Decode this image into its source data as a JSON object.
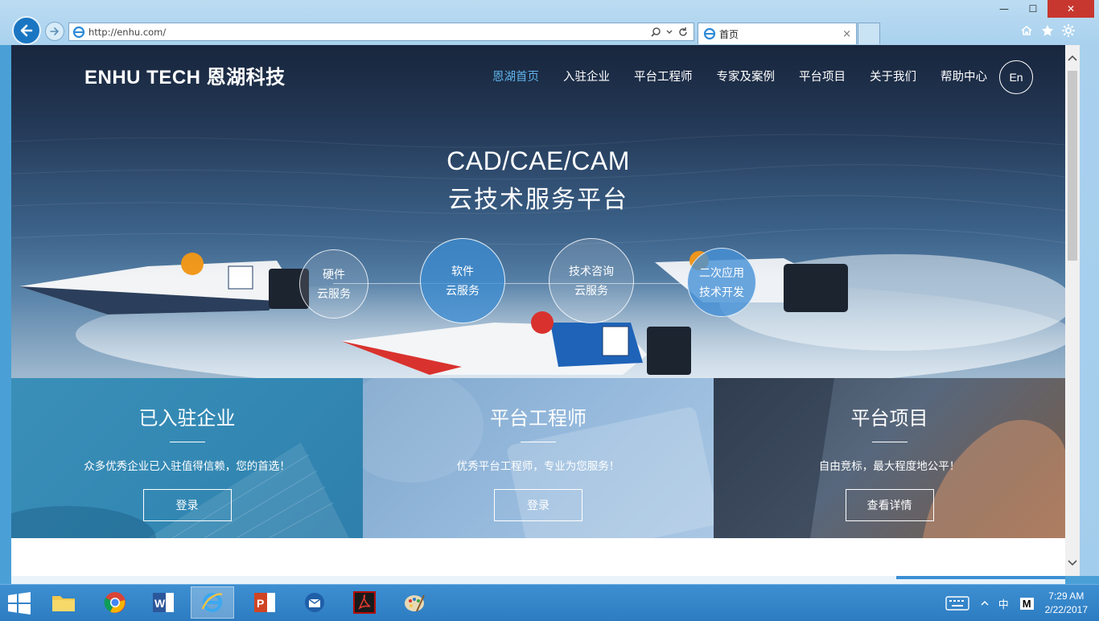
{
  "browser": {
    "url": "http://enhu.com/",
    "tab_title": "首页",
    "tab_close": "×",
    "window": {
      "minimize": "—",
      "maximize": "☐",
      "close": "✕"
    }
  },
  "site": {
    "brand": "ENHU TECH 恩湖科技",
    "nav": [
      {
        "label": "恩湖首页",
        "active": true
      },
      {
        "label": "入驻企业"
      },
      {
        "label": "平台工程师"
      },
      {
        "label": "专家及案例"
      },
      {
        "label": "平台项目"
      },
      {
        "label": "关于我们"
      },
      {
        "label": "帮助中心"
      }
    ],
    "lang_button": "En",
    "hero": {
      "title_line1": "CAD/CAE/CAM",
      "title_line2": "云技术服务平台",
      "services": [
        {
          "line1": "硬件",
          "line2": "云服务"
        },
        {
          "line1": "软件",
          "line2": "云服务"
        },
        {
          "line1": "技术咨询",
          "line2": "云服务"
        },
        {
          "line1": "二次应用",
          "line2": "技术开发"
        }
      ]
    },
    "panels": [
      {
        "title": "已入驻企业",
        "subtitle": "众多优秀企业已入驻值得信赖，您的首选！",
        "button": "登录"
      },
      {
        "title": "平台工程师",
        "subtitle": "优秀平台工程师，专业为您服务！",
        "button": "登录"
      },
      {
        "title": "平台项目",
        "subtitle": "自由竞标，最大程度地公平！",
        "button": "查看详情"
      }
    ]
  },
  "taskbar": {
    "apps": [
      "file-explorer",
      "chrome",
      "word",
      "internet-explorer",
      "powerpoint",
      "thunderbird",
      "acrobat",
      "paint"
    ],
    "active_app": "internet-explorer",
    "tray": {
      "ime": "中",
      "ime_mode": "M",
      "time": "7:29 AM",
      "date": "2/22/2017"
    }
  },
  "colors": {
    "accent": "#1a76c2",
    "nav_active": "#5fb3ea",
    "taskbar": "#2d7cc2"
  }
}
